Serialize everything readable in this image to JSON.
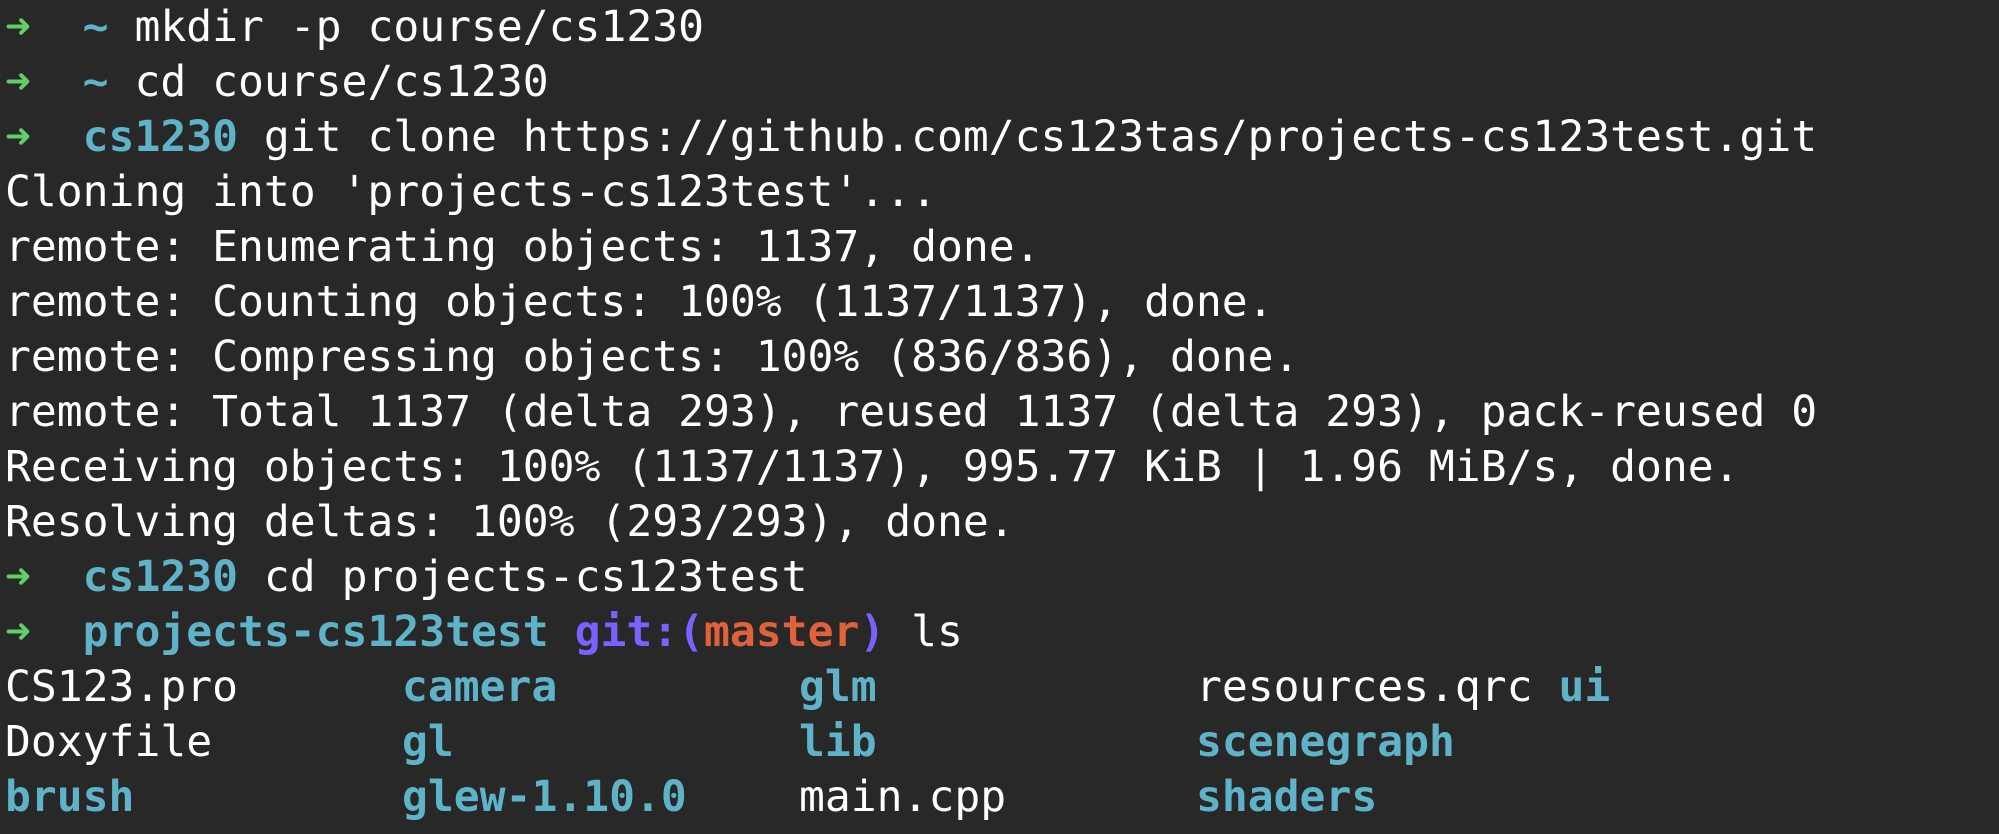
{
  "terminal": {
    "lines": [
      {
        "kind": "prompt",
        "arrow": "➜",
        "dir": "~",
        "cmd": "mkdir -p course/cs1230"
      },
      {
        "kind": "prompt",
        "arrow": "➜",
        "dir": "~",
        "cmd": "cd course/cs1230"
      },
      {
        "kind": "prompt",
        "arrow": "➜",
        "dir": "cs1230",
        "cmd": "git clone https://github.com/cs123tas/projects-cs123test.git"
      },
      {
        "kind": "output",
        "text": "Cloning into 'projects-cs123test'..."
      },
      {
        "kind": "output",
        "text": "remote: Enumerating objects: 1137, done."
      },
      {
        "kind": "output",
        "text": "remote: Counting objects: 100% (1137/1137), done."
      },
      {
        "kind": "output",
        "text": "remote: Compressing objects: 100% (836/836), done."
      },
      {
        "kind": "output",
        "text": "remote: Total 1137 (delta 293), reused 1137 (delta 293), pack-reused 0"
      },
      {
        "kind": "output",
        "text": "Receiving objects: 100% (1137/1137), 995.77 KiB | 1.96 MiB/s, done."
      },
      {
        "kind": "output",
        "text": "Resolving deltas: 100% (293/293), done."
      },
      {
        "kind": "prompt",
        "arrow": "➜",
        "dir": "cs1230",
        "cmd": "cd projects-cs123test"
      },
      {
        "kind": "git-prompt",
        "arrow": "➜",
        "dir": "projects-cs123test",
        "git_label": "git:(",
        "branch": "master",
        "git_close": ")",
        "cmd": "ls"
      }
    ],
    "ls_rows": [
      [
        {
          "name": "CS123.pro",
          "type": "file"
        },
        {
          "name": "camera",
          "type": "dir"
        },
        {
          "name": "glm",
          "type": "dir"
        },
        {
          "name": "resources.qrc",
          "type": "file",
          "extra": "ui"
        }
      ],
      [
        {
          "name": "Doxyfile",
          "type": "file"
        },
        {
          "name": "gl",
          "type": "dir"
        },
        {
          "name": "lib",
          "type": "dir"
        },
        {
          "name": "scenegraph",
          "type": "dir"
        }
      ],
      [
        {
          "name": "brush",
          "type": "dir"
        },
        {
          "name": "glew-1.10.0",
          "type": "dir"
        },
        {
          "name": "main.cpp",
          "type": "file"
        },
        {
          "name": "shaders",
          "type": "dir"
        }
      ]
    ]
  },
  "colors": {
    "background": "#282828",
    "arrow": "#5fd068",
    "directory": "#5fb3c9",
    "git_label": "#7b61ff",
    "git_branch": "#e0623c",
    "text": "#ffffff"
  }
}
